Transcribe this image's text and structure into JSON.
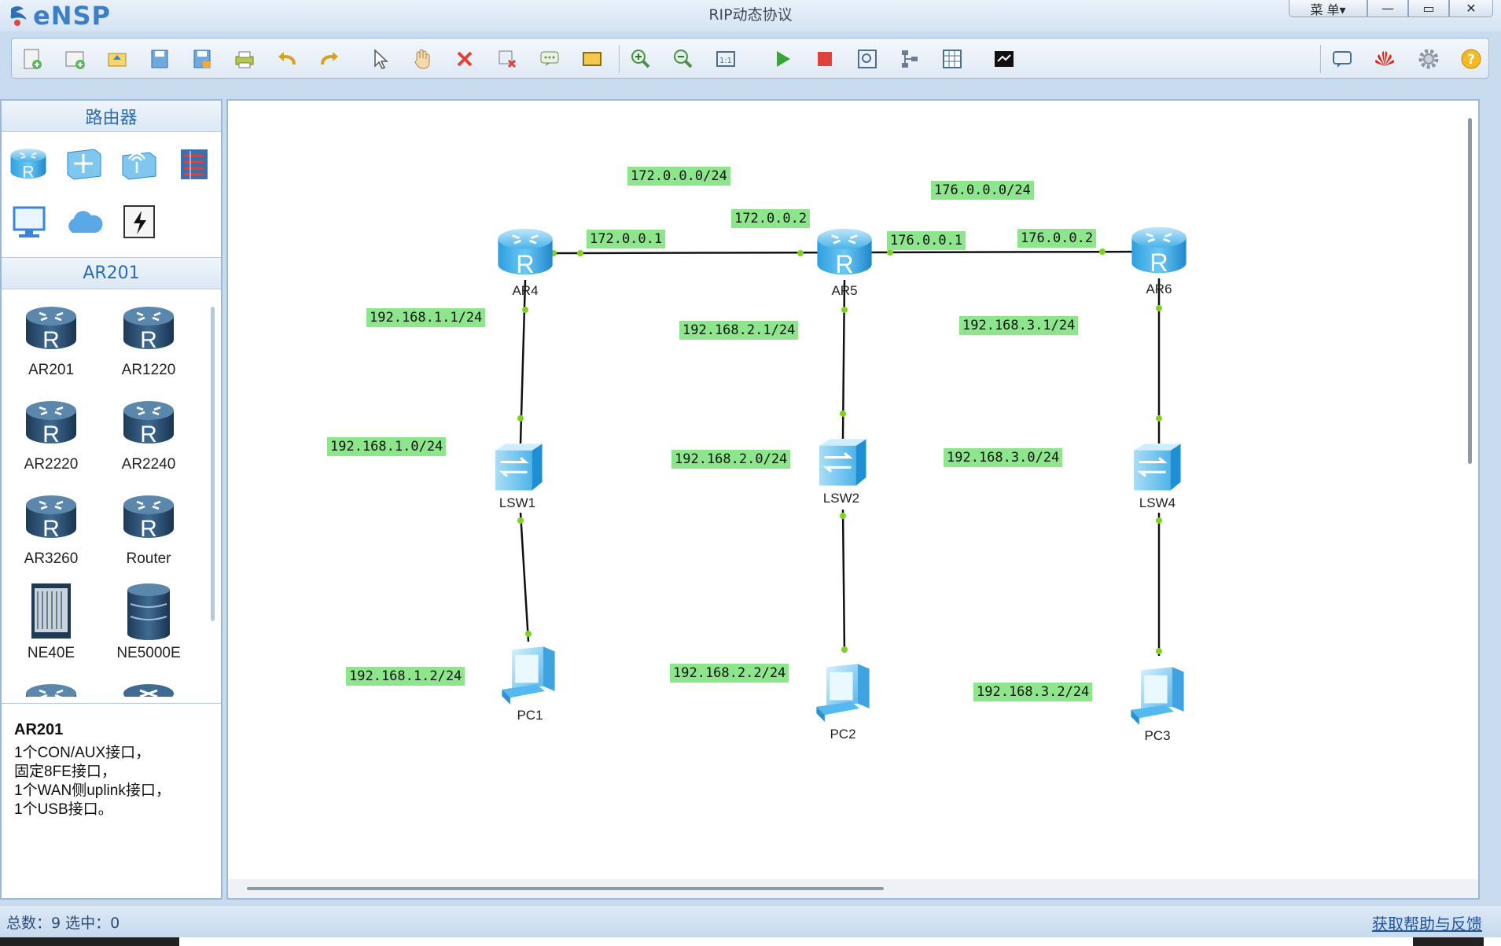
{
  "app": {
    "name": "eNSP",
    "window_title": "RIP动态协议"
  },
  "window_controls": {
    "menu": "菜 单▾",
    "minimize": "—",
    "maximize": "▭",
    "close": "✕"
  },
  "toolbar": {
    "buttons": [
      "new-topology-icon",
      "new-page-icon",
      "open-icon",
      "save-icon",
      "save-as-icon",
      "print-icon",
      "undo-icon",
      "redo-icon",
      "select-pointer-icon",
      "pan-hand-icon",
      "delete-icon",
      "delete-link-icon",
      "text-note-icon",
      "rectangle-icon",
      "zoom-in-icon",
      "zoom-out-icon",
      "fit-view-icon",
      "start-device-icon",
      "stop-device-icon",
      "capture-icon",
      "topology-icon",
      "grid-icon",
      "terminal-icon"
    ],
    "right_buttons": [
      "chat-icon",
      "huawei-icon",
      "settings-gear-icon",
      "help-icon"
    ]
  },
  "left_panel": {
    "category_title": "路由器",
    "categories": [
      "router-category-icon",
      "switch-category-icon",
      "wlan-category-icon",
      "firewall-category-icon",
      "pc-category-icon",
      "cloud-category-icon",
      "other-device-icon"
    ],
    "device_title": "AR201",
    "devices": [
      {
        "name": "AR201"
      },
      {
        "name": "AR1220"
      },
      {
        "name": "AR2220"
      },
      {
        "name": "AR2240"
      },
      {
        "name": "AR3260"
      },
      {
        "name": "Router"
      },
      {
        "name": "NE40E"
      },
      {
        "name": "NE5000E"
      }
    ],
    "description": {
      "title": "AR201",
      "lines": [
        "1个CON/AUX接口，",
        "固定8FE接口，",
        "1个WAN侧uplink接口，",
        "1个USB接口。"
      ]
    }
  },
  "topology": {
    "nodes": {
      "ar4": "AR4",
      "ar5": "AR5",
      "ar6": "AR6",
      "lsw1": "LSW1",
      "lsw2": "LSW2",
      "lsw4": "LSW4",
      "pc1": "PC1",
      "pc2": "PC2",
      "pc3": "PC3"
    },
    "labels": {
      "net_172": "172.0.0.0/24",
      "net_176": "176.0.0.0/24",
      "ip_172_2": "172.0.0.2",
      "ip_172_1": "172.0.0.1",
      "ip_176_1": "176.0.0.1",
      "ip_176_2": "176.0.0.2",
      "gw_1": "192.168.1.1/24",
      "gw_2": "192.168.2.1/24",
      "gw_3": "192.168.3.1/24",
      "net_1": "192.168.1.0/24",
      "net_2": "192.168.2.0/24",
      "net_3": "192.168.3.0/24",
      "pc_1": "192.168.1.2/24",
      "pc_2": "192.168.2.2/24",
      "pc_3": "192.168.3.2/24"
    }
  },
  "status": {
    "left": "总数：9  选中：0",
    "right": "获取帮助与反馈"
  },
  "colors": {
    "ip_label_bg": "#8ee68c",
    "link_dot": "#7ed321",
    "accent": "#2a6cb3"
  }
}
